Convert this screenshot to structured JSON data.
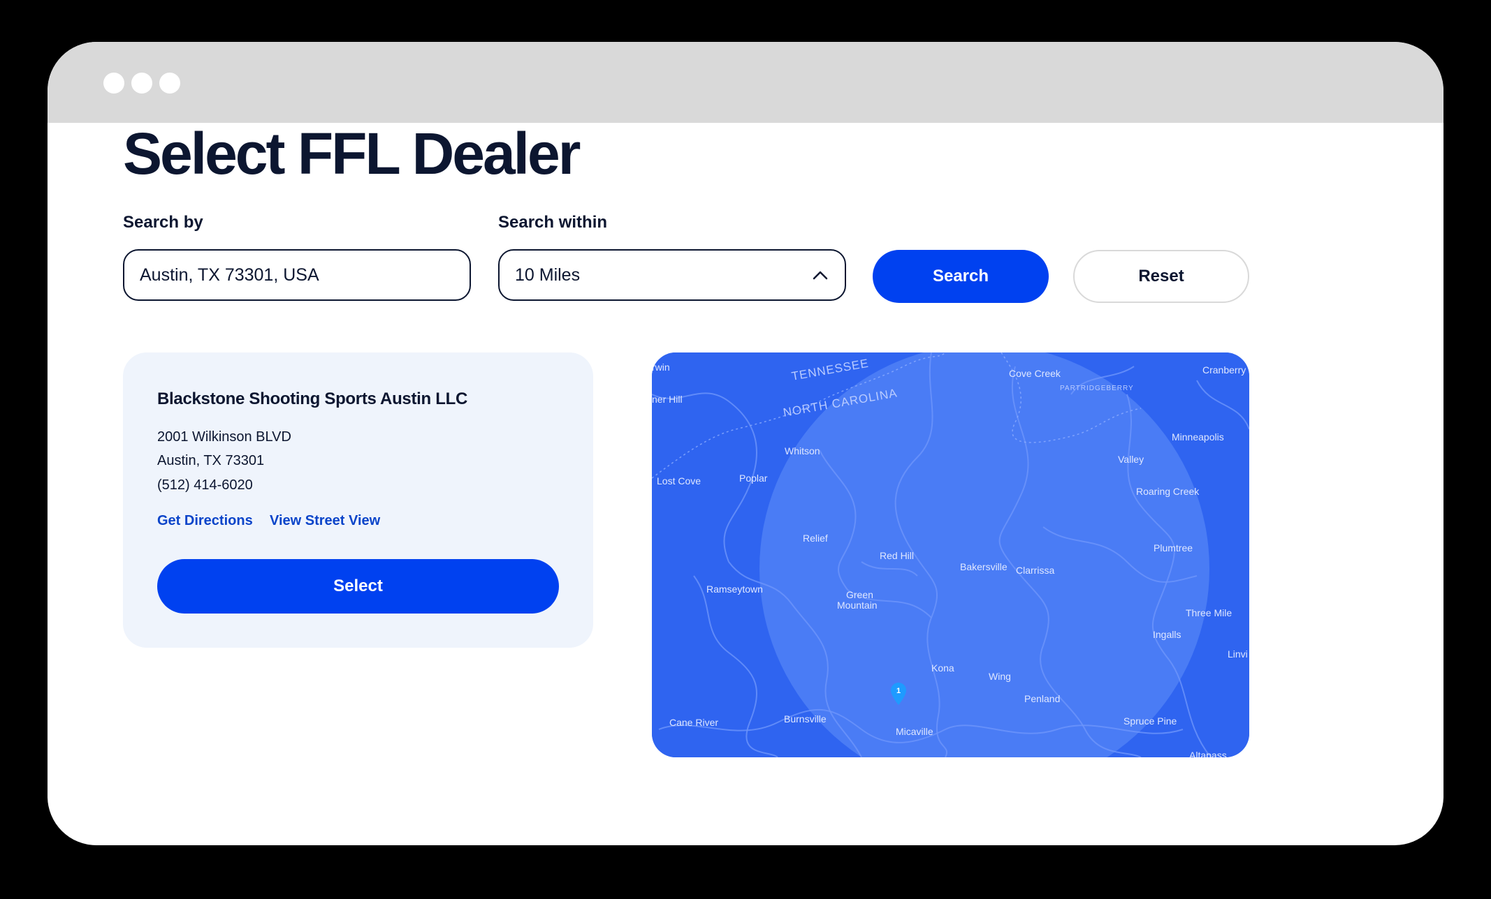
{
  "window": {
    "title_bar_dots": [
      "dot",
      "dot",
      "dot"
    ]
  },
  "page": {
    "title": "Select FFL Dealer"
  },
  "search": {
    "search_by_label": "Search by",
    "search_by_value": "Austin, TX 73301, USA",
    "search_within_label": "Search within",
    "search_within_value": "10 Miles",
    "search_button": "Search",
    "reset_button": "Reset"
  },
  "dealer": {
    "name": "Blackstone Shooting Sports Austin LLC",
    "address_line1": "2001 Wilkinson BLVD",
    "address_line2": "Austin, TX 73301",
    "phone": "(512) 414-6020",
    "get_directions": "Get Directions",
    "view_street_view": "View Street View",
    "select_button": "Select"
  },
  "map": {
    "pin_label": "1",
    "places": {
      "irwin": "rwin",
      "tennessee": "TENNESSEE",
      "cove_creek": "Cove Creek",
      "cranberry": "Cranberry",
      "partridgeberry": "PARTRIDGEBERRY",
      "ner_hill": "ner Hill",
      "north_carolina": "NORTH CAROLINA",
      "minneapolis": "Minneapolis",
      "whitson": "Whitson",
      "valley": "Valley",
      "lost_cove": "Lost Cove",
      "poplar": "Poplar",
      "roaring_creek": "Roaring Creek",
      "relief": "Relief",
      "plumtree": "Plumtree",
      "red_hill": "Red Hill",
      "bakersville": "Bakersville",
      "clarrissa": "Clarrissa",
      "ramseytown": "Ramseytown",
      "green": "Green",
      "mountain": "Mountain",
      "three_mile": "Three Mile",
      "ingalls": "Ingalls",
      "linville": "Linvi",
      "kona": "Kona",
      "wing": "Wing",
      "penland": "Penland",
      "cane_river": "Cane River",
      "burnsville": "Burnsville",
      "spruce_pine": "Spruce Pine",
      "micaville": "Micaville",
      "altapass": "Altapass"
    },
    "colors": {
      "background": "#2f64f0",
      "radius_circle": "#4a7cf5",
      "pin": "#1e9bff"
    }
  },
  "colors": {
    "primary": "#0041f0",
    "text": "#0c1630",
    "link": "#0a44c9",
    "card_bg": "#eff4fc",
    "titlebar": "#d9d9d9"
  }
}
